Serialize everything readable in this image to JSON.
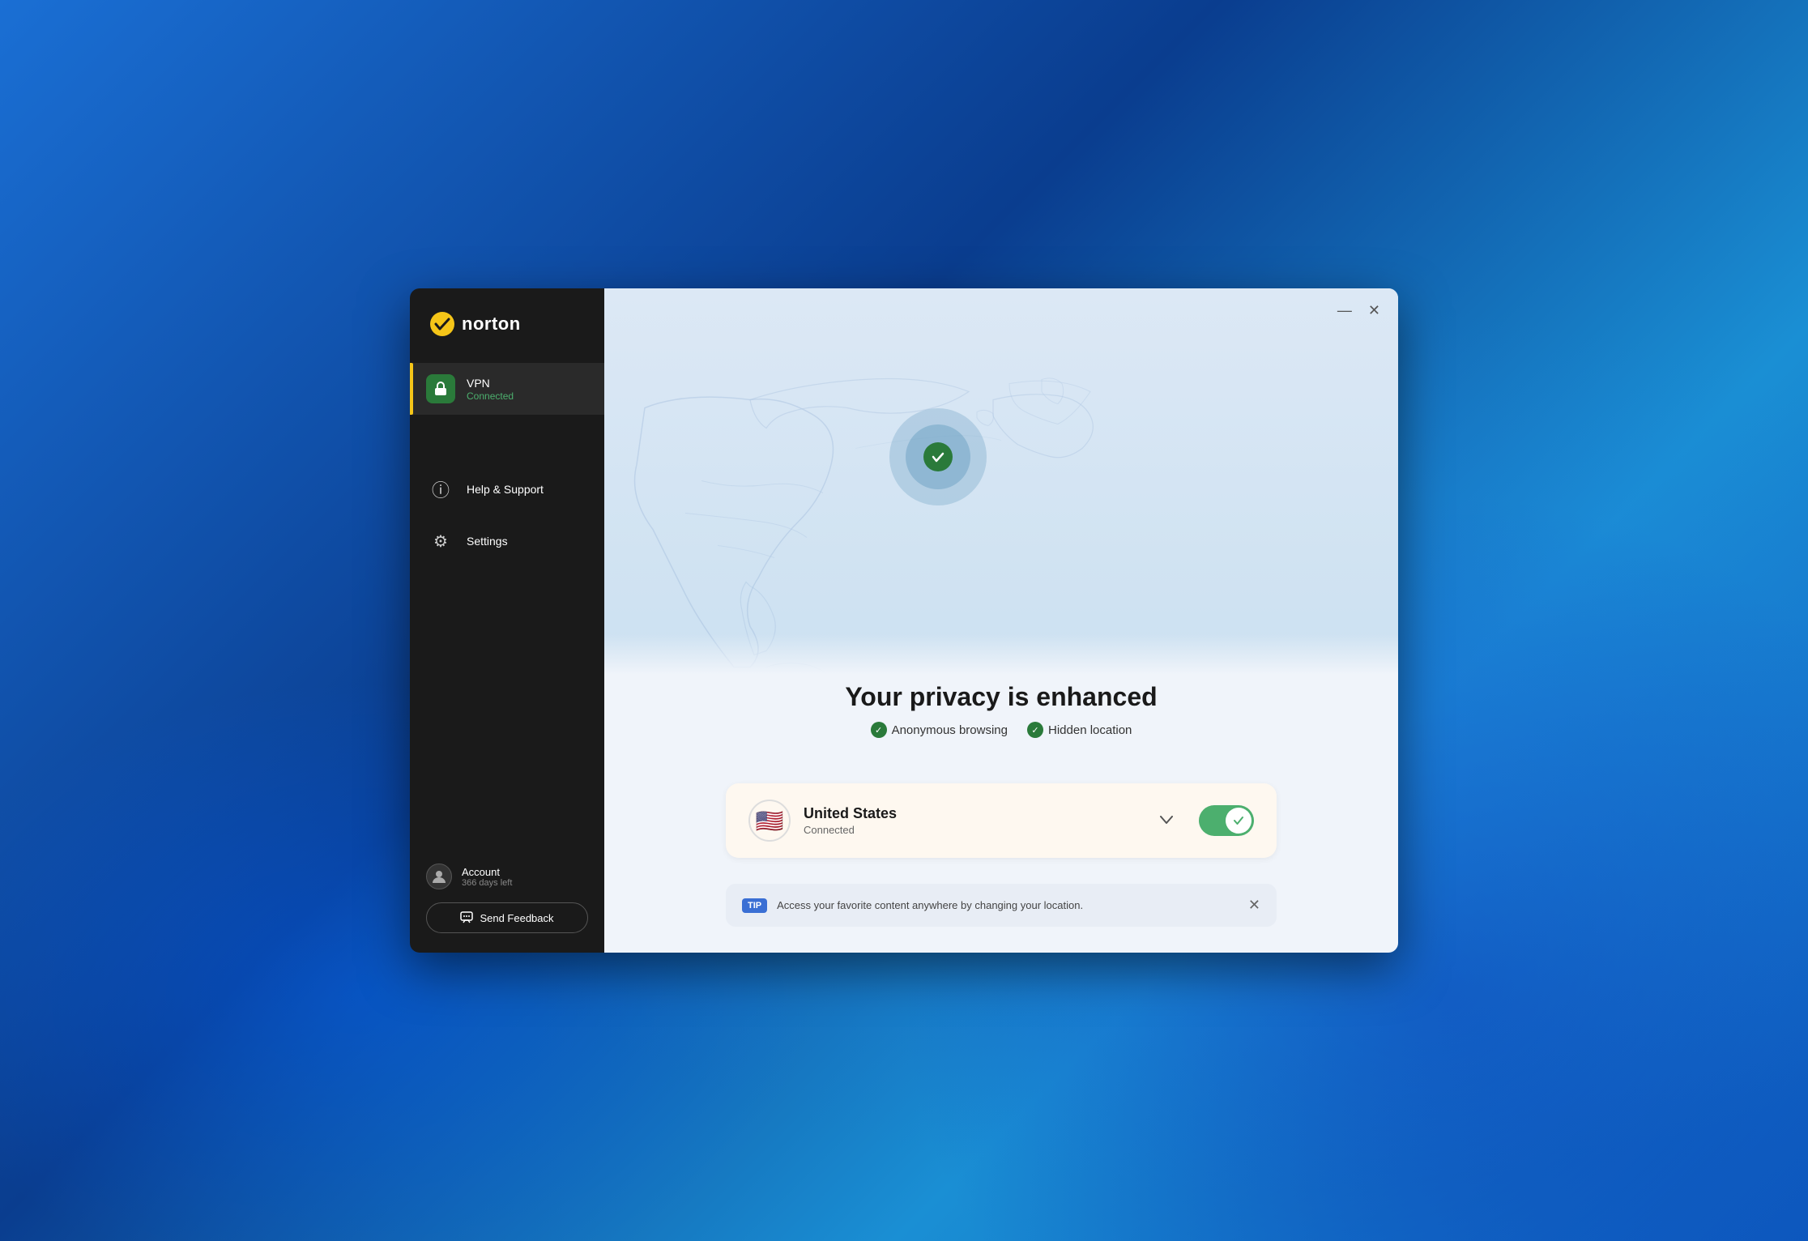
{
  "logo": {
    "brand": "norton",
    "icon": "✓"
  },
  "sidebar": {
    "nav_items": [
      {
        "id": "vpn",
        "label": "VPN",
        "sublabel": "Connected",
        "icon": "🔒",
        "active": true
      },
      {
        "id": "help-support",
        "label": "Help & Support",
        "sublabel": "",
        "icon": "?",
        "active": false
      },
      {
        "id": "settings",
        "label": "Settings",
        "sublabel": "",
        "icon": "⚙",
        "active": false
      }
    ],
    "account": {
      "label": "Account",
      "sublabel": "366 days left"
    },
    "feedback_btn": "Send Feedback"
  },
  "main": {
    "window_controls": {
      "minimize": "—",
      "close": "✕"
    },
    "privacy_title": "Your privacy is enhanced",
    "privacy_badges": [
      {
        "label": "Anonymous browsing"
      },
      {
        "label": "Hidden location"
      }
    ],
    "connection": {
      "country": "United States",
      "status": "Connected",
      "flag": "🇺🇸"
    },
    "toggle_state": "on",
    "tip": {
      "badge": "TIP",
      "text": "Access your favorite content anywhere by changing your location."
    }
  },
  "colors": {
    "accent_green": "#4caf6e",
    "accent_yellow": "#f5c518",
    "accent_blue": "#3a6fd4",
    "dark_bg": "#1a1a1a",
    "active_nav": "#2a2a2a"
  }
}
